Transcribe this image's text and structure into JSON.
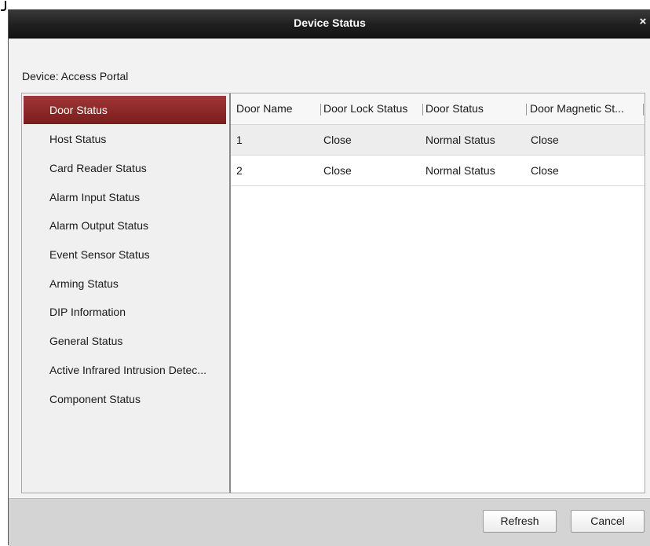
{
  "window": {
    "title": "Device Status",
    "close_glyph": "×"
  },
  "device": {
    "label": "Device: Access Portal"
  },
  "sidebar": {
    "items": [
      {
        "label": "Door Status"
      },
      {
        "label": "Host Status"
      },
      {
        "label": "Card Reader Status"
      },
      {
        "label": "Alarm Input Status"
      },
      {
        "label": "Alarm Output Status"
      },
      {
        "label": "Event Sensor Status"
      },
      {
        "label": "Arming Status"
      },
      {
        "label": "DIP Information"
      },
      {
        "label": "General Status"
      },
      {
        "label": "Active Infrared Intrusion Detec..."
      },
      {
        "label": "Component Status"
      }
    ],
    "active_index": 0,
    "active_color": "#8b2323"
  },
  "table": {
    "columns": [
      "Door Name",
      "Door Lock Status",
      "Door Status",
      "Door Magnetic St..."
    ],
    "rows": [
      [
        "1",
        "Close",
        "Normal Status",
        "Close"
      ],
      [
        "2",
        "Close",
        "Normal Status",
        "Close"
      ]
    ]
  },
  "footer": {
    "refresh_label": "Refresh",
    "cancel_label": "Cancel"
  }
}
